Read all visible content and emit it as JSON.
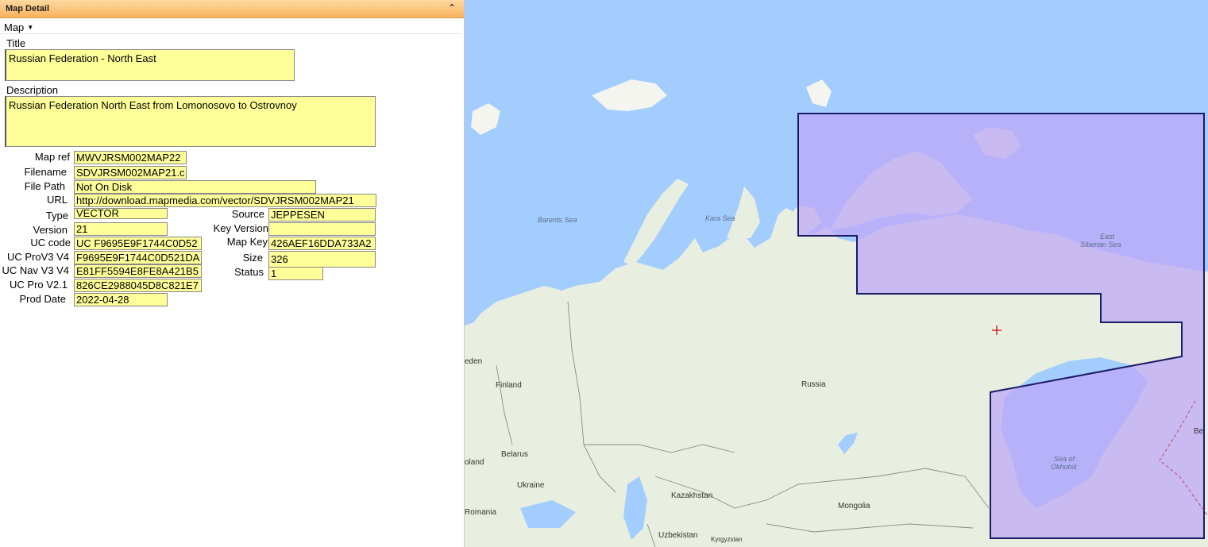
{
  "panel": {
    "title": "Map Detail",
    "collapse_icon": "double-chevron-up-icon"
  },
  "menu": {
    "map_label": "Map"
  },
  "fields": {
    "title_label": "Title",
    "title_value": "Russian Federation - North East",
    "description_label": "Description",
    "description_value": "Russian Federation North East from Lomonosovo to Ostrovnoy",
    "map_ref_label": "Map ref",
    "map_ref_value": "MWVJRSM002MAP22",
    "filename_label": "Filename",
    "filename_value": "SDVJRSM002MAP21.c",
    "file_path_label": "File Path",
    "file_path_value": "Not On Disk",
    "url_label": "URL",
    "url_value": "http://download.mapmedia.com/vector/SDVJRSM002MAP21",
    "type_label": "Type",
    "type_value": "VECTOR",
    "version_label": "Version",
    "version_value": "21",
    "uc_code_label": "UC code",
    "uc_code_value": "UC F9695E9F1744C0D52",
    "uc_prov3_label": "UC ProV3 V4",
    "uc_prov3_value": "F9695E9F1744C0D521DA",
    "uc_navv3_label": "UC Nav V3 V4",
    "uc_navv3_value": "E81FF5594E8FE8A421B5",
    "uc_prov21_label": "UC Pro V2.1",
    "uc_prov21_value": "826CE2988045D8C821E7",
    "prod_date_label": "Prod Date",
    "prod_date_value": "2022-04-28",
    "source_label": "Source",
    "source_value": "JEPPESEN",
    "key_version_label": "Key Version",
    "key_version_value": "",
    "map_key_label": "Map Key",
    "map_key_value": "426AEF16DDA733A2",
    "size_label": "Size",
    "size_value": "326",
    "status_label": "Status",
    "status_value": "1"
  },
  "map": {
    "labels": {
      "barents_sea": "Barents Sea",
      "kara_sea": "Kara Sea",
      "east_siberian_sea_1": "East",
      "east_siberian_sea_2": "Siberian Sea",
      "sea_of_okhotsk_1": "Sea of",
      "sea_of_okhotsk_2": "Okhotsk",
      "russia": "Russia",
      "finland": "Finland",
      "sweden_partial": "eden",
      "belarus": "Belarus",
      "poland_partial": "oland",
      "ukraine": "Ukraine",
      "romania": "Romania",
      "kazakhstan": "Kazakhstan",
      "mongolia": "Mongolia",
      "uzbekistan": "Uzbekistan",
      "kyrgyzstan": "Kyrgyzstan",
      "bering_partial": "Be"
    },
    "colors": {
      "water": "#a3ccff",
      "land": "#e9efe0",
      "coverage": "#bda8f7",
      "coverage_border": "#1a1a66",
      "center_marker": "#cc0000"
    }
  }
}
